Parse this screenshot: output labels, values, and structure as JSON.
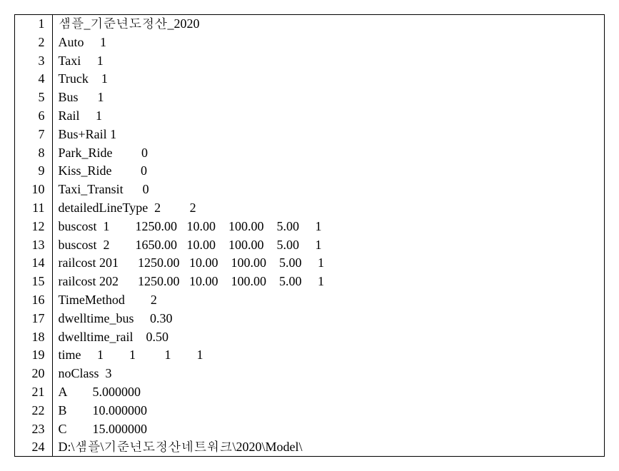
{
  "rows": [
    {
      "n": "1",
      "c0": "샘플_기준년도정산_2020"
    },
    {
      "n": "2",
      "c0": "Auto",
      "c1": "1"
    },
    {
      "n": "3",
      "c0": "Taxi",
      "c1": "1"
    },
    {
      "n": "4",
      "c0": "Truck",
      "c1": "1"
    },
    {
      "n": "5",
      "c0": "Bus",
      "c1": "1"
    },
    {
      "n": "6",
      "c0": "Rail",
      "c1": "1"
    },
    {
      "n": "7",
      "c0": "Bus+Rail",
      "c1": "1"
    },
    {
      "n": "8",
      "c0": "Park_Ride",
      "c2": "0"
    },
    {
      "n": "9",
      "c0": "Kiss_Ride",
      "c2": "0"
    },
    {
      "n": "10",
      "c0": "Taxi_Transit",
      "c2": "0"
    },
    {
      "n": "11",
      "c0": "detailedLineType",
      "c2": "2",
      "c3": "2"
    },
    {
      "n": "12",
      "c0": "buscost",
      "c1": "1",
      "c2": "1250.00",
      "c3": "10.00",
      "c4": "100.00",
      "c5": "5.00",
      "c6": "1"
    },
    {
      "n": "13",
      "c0": "buscost",
      "c1": "2",
      "c2": "1650.00",
      "c3": "10.00",
      "c4": "100.00",
      "c5": "5.00",
      "c6": "1"
    },
    {
      "n": "14",
      "c0": "railcost",
      "c1": "201",
      "c2": "1250.00",
      "c3": "10.00",
      "c4": "100.00",
      "c5": "5.00",
      "c6": "1"
    },
    {
      "n": "15",
      "c0": "railcost",
      "c1": "202",
      "c2": "1250.00",
      "c3": "10.00",
      "c4": "100.00",
      "c5": "5.00",
      "c6": "1"
    },
    {
      "n": "16",
      "c0": "TimeMethod",
      "c2": "2"
    },
    {
      "n": "17",
      "c0": "dwelltime_bus",
      "c2": "0.30"
    },
    {
      "n": "18",
      "c0": "dwelltime_rail",
      "c2": "0.50"
    },
    {
      "n": "19",
      "c0": "time",
      "c1": "1",
      "c2": "1",
      "c3": "1",
      "c4": "1"
    },
    {
      "n": "20",
      "c0": "noClass",
      "c1": "3"
    },
    {
      "n": "21",
      "c0": "A",
      "c1b": "5.000000"
    },
    {
      "n": "22",
      "c0": "B",
      "c1b": "10.000000"
    },
    {
      "n": "23",
      "c0": "C",
      "c1b": "15.000000"
    },
    {
      "n": "24",
      "c0": "D:\\샘플\\기준년도정산네트워크\\2020\\Model\\"
    }
  ]
}
